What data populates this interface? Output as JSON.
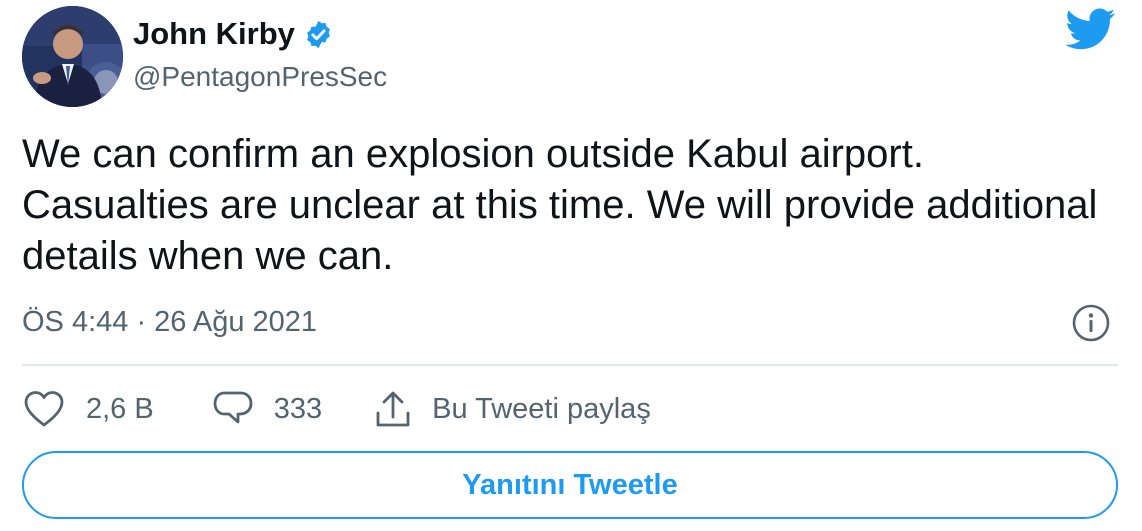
{
  "author": {
    "display_name": "John Kirby",
    "handle": "@PentagonPresSec",
    "verified": true,
    "avatar_icon": "profile-photo"
  },
  "brand": {
    "icon": "twitter-bird-icon",
    "color": "#1d9bf0"
  },
  "tweet": {
    "text": "We can confirm an explosion outside Kabul airport.  Casualties are unclear at this time.  We will provide additional details when we can.",
    "timestamp": "ÖS 4:44 · 26 Ağu 2021"
  },
  "actions": {
    "like_count": "2,6 B",
    "reply_count": "333",
    "share_label": "Bu Tweeti paylaş"
  },
  "reply_button": {
    "label": "Yanıtını Tweetle"
  },
  "colors": {
    "text": "#0f1419",
    "secondary": "#536471",
    "accent": "#1d9bf0",
    "divider": "#e1e6ea"
  }
}
